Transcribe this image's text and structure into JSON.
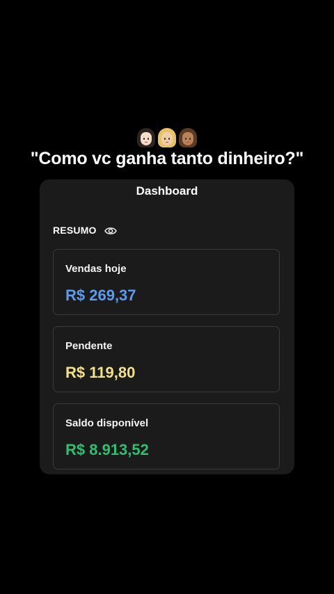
{
  "header": {
    "emojis": [
      "woman-emoji",
      "woman-blond-emoji",
      "woman-medium-emoji"
    ],
    "headline": "\"Como vc ganha tanto dinheiro?\""
  },
  "dashboard": {
    "title": "Dashboard",
    "section_label": "RESUMO",
    "toggle_icon": "eye-icon",
    "cards": [
      {
        "label": "Vendas hoje",
        "value": "R$ 269,37",
        "color": "#5b9cf0"
      },
      {
        "label": "Pendente",
        "value": "R$ 119,80",
        "color": "#f3e08a"
      },
      {
        "label": "Saldo disponível",
        "value": "R$ 8.913,52",
        "color": "#2fbf71"
      }
    ]
  },
  "colors": {
    "background": "#000000",
    "panel": "#1b1b1b",
    "card_border": "#3a3a3a"
  }
}
